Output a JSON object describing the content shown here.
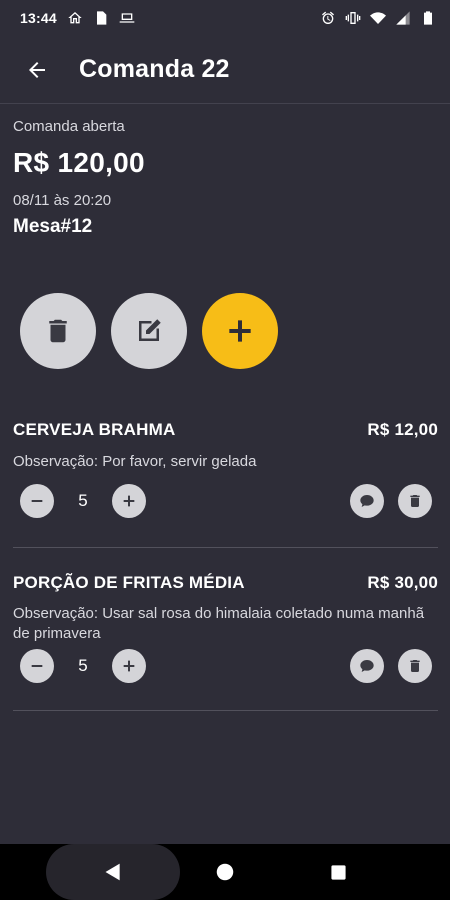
{
  "status_bar": {
    "time": "13:44",
    "left_icons": [
      "home-icon",
      "file-icon",
      "laptop-icon"
    ],
    "right_icons": [
      "alarm-icon",
      "vibrate-icon",
      "wifi-icon",
      "signal-icon",
      "battery-icon"
    ]
  },
  "app_bar": {
    "back_icon": "arrow-left-icon",
    "title": "Comanda 22"
  },
  "order": {
    "status": "Comanda aberta",
    "total": "R$ 120,00",
    "datetime": "08/11 às 20:20",
    "table": "Mesa#12"
  },
  "actions": [
    {
      "name": "delete-order-button",
      "icon": "trash-icon"
    },
    {
      "name": "edit-order-button",
      "icon": "edit-icon"
    },
    {
      "name": "add-item-button",
      "icon": "plus-icon"
    }
  ],
  "items": [
    {
      "name": "CERVEJA BRAHMA",
      "price": "R$ 12,00",
      "note": "Observação: Por favor, servir gelada",
      "quantity": "5"
    },
    {
      "name": "PORÇÃO DE FRITAS MÉDIA",
      "price": "R$ 30,00",
      "note": "Observação: Usar sal rosa do himalaia coletado numa manhã de primavera",
      "quantity": "5"
    }
  ],
  "colors": {
    "background": "#2e2d38",
    "accent": "#f7bd17",
    "button_gray": "#d4d4d8"
  },
  "nav_bar": {
    "icons": [
      "nav-back-icon",
      "nav-home-icon",
      "nav-recents-icon"
    ]
  }
}
